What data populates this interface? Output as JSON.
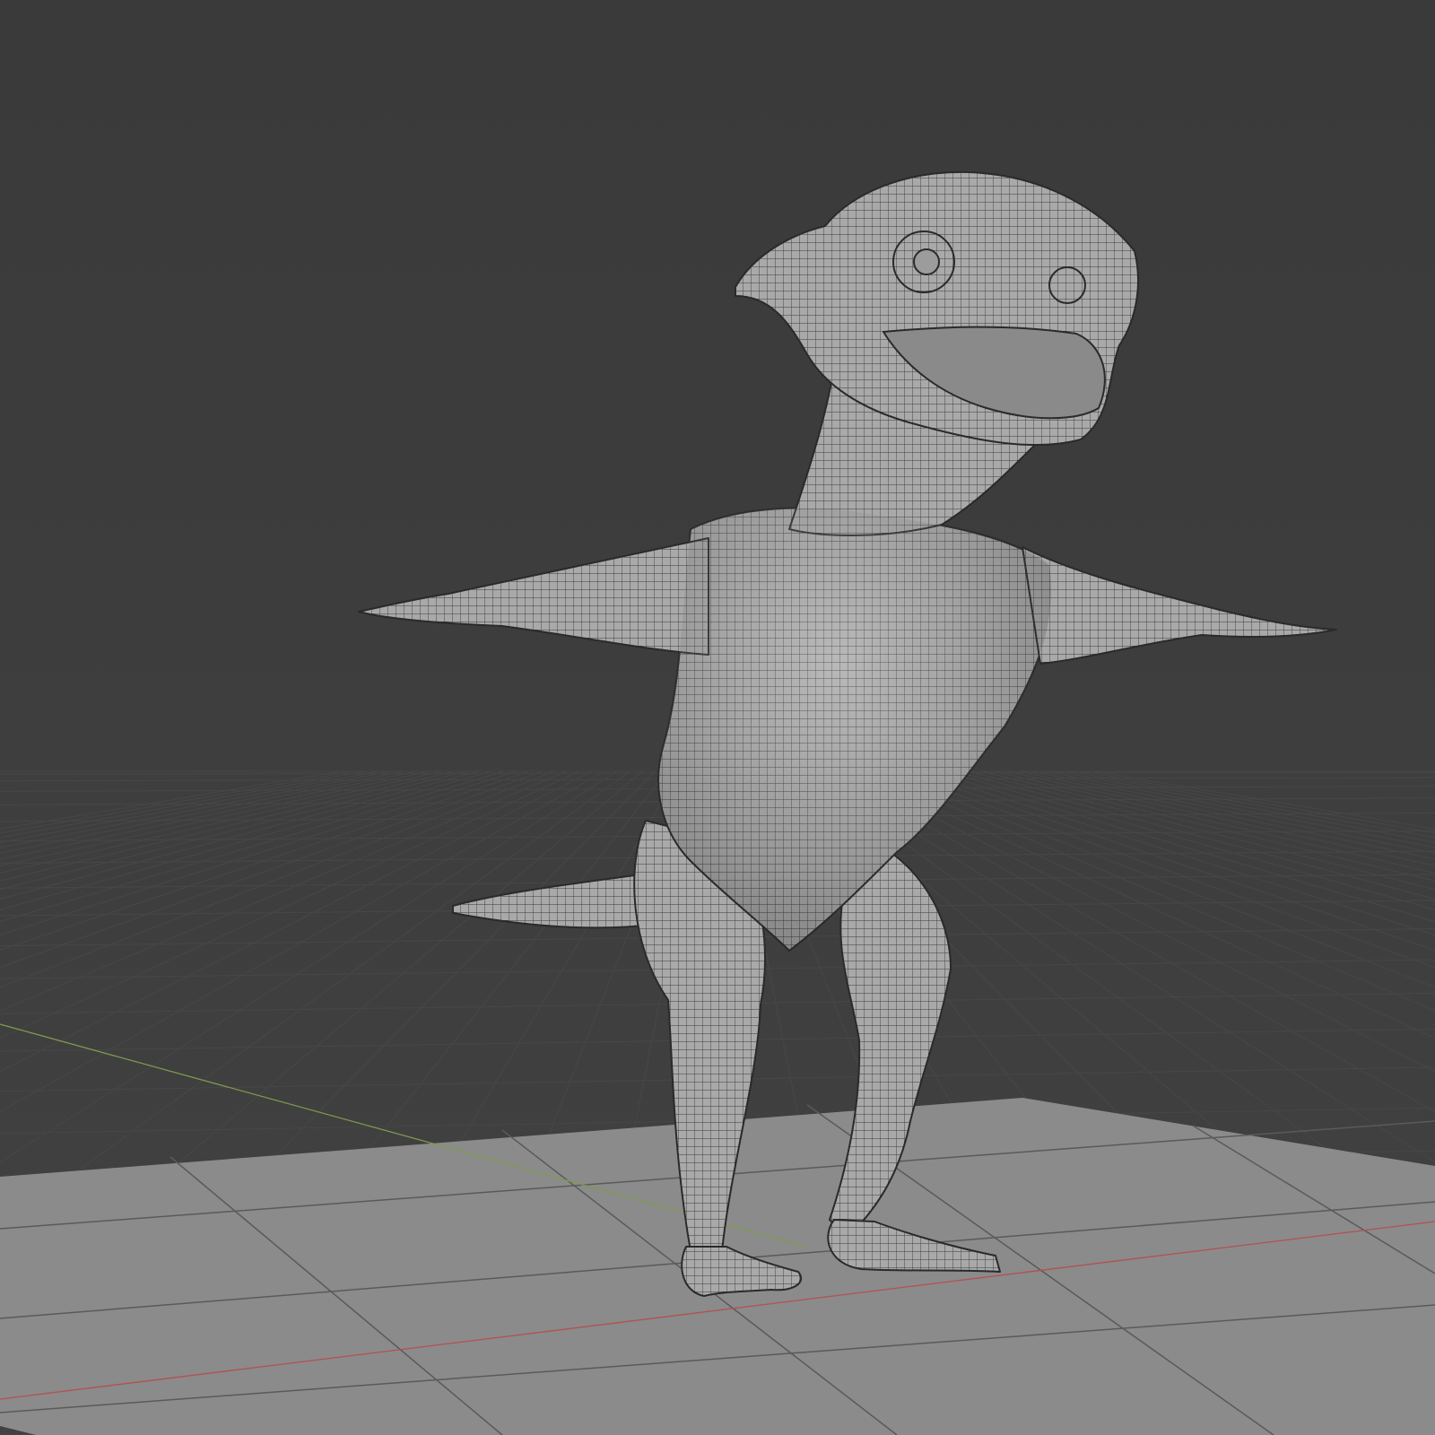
{
  "viewport": {
    "background_top": "#3a3a3a",
    "background_bottom": "#404040",
    "grid_line_color": "#4a4a4a",
    "x_axis_color": "#b04a4a",
    "y_axis_color": "#7a9a4a"
  },
  "ground_plane": {
    "color": "#8c8c8c",
    "edge_color": "#555555"
  },
  "model": {
    "icon": "lizard-creature-wireframe-mesh",
    "surface_color": "#a8a8a8",
    "wire_color": "#3a3a3a"
  }
}
